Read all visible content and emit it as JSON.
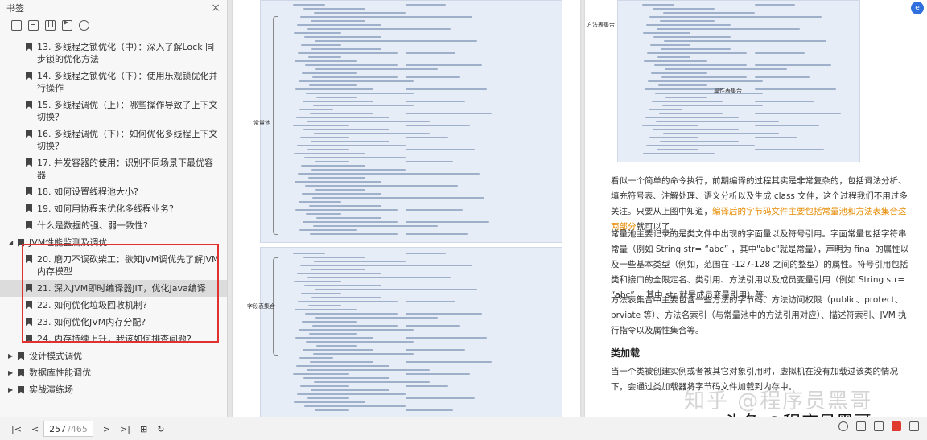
{
  "sidebar": {
    "title": "书签",
    "close": "×",
    "tools": [
      "bookmark-add-icon",
      "bookmark-remove-icon",
      "bookmark-icon",
      "bookmark-play-icon",
      "bookmark-settings-icon"
    ],
    "items": [
      {
        "label": "13. 多线程之锁优化（中）：深入了解Lock 同步锁的优化方法"
      },
      {
        "label": "14. 多线程之锁优化（下）：使用乐观锁优化并行操作"
      },
      {
        "label": "15. 多线程调优（上）：哪些操作导致了上下文切换？"
      },
      {
        "label": "16. 多线程调优（下）：如何优化多线程上下文切换？"
      },
      {
        "label": "17. 并发容器的使用：识别不同场景下最优容器"
      },
      {
        "label": "18. 如何设置线程池大小?"
      },
      {
        "label": "19. 如何用协程来优化多线程业务?"
      },
      {
        "label": "什么是数据的强、弱一致性?"
      }
    ],
    "group_jvm": "JVM性能监测及调优",
    "jvm_items": [
      {
        "label": "20. 磨刀不误砍柴工：欲知JVM调优先了解JVM内存模型"
      },
      {
        "label": "21. 深入JVM即时编译器JIT，优化Java编译"
      },
      {
        "label": "22. 如何优化垃圾回收机制?"
      },
      {
        "label": "23. 如何优化JVM内存分配?"
      },
      {
        "label": "24. 内存持续上升，我该如何排查问题?"
      }
    ],
    "groups_after": [
      {
        "label": "设计模式调优"
      },
      {
        "label": "数据库性能调优"
      },
      {
        "label": "实战演练场"
      }
    ]
  },
  "doc": {
    "labels": {
      "constant_pool": "常量池",
      "field_table": "字段表集合",
      "method_table": "方法表集合",
      "attr_table": "属性表集合"
    },
    "para1_a": "看似一个简单的命令执行，前期编译的过程其实是非常复杂的，包括词法分析、填充符号表、注解处理、语义分析以及生成 class 文件，这个过程我们不用过多关注。只要从上图中知道，",
    "para1_hl": "编译后的字节码文件主要包括常量池和方法表集合这两部分",
    "para1_b": "就可以了。",
    "para2": "常量池主要记录的是类文件中出现的字面量以及符号引用。字面常量包括字符串常量（例如 String str= “abc” ，其中\"abc\"就是常量），声明为 final 的属性以及一些基本类型（例如，范围在 -127-128 之间的整型）的属性。符号引用包括类和接口的全限定名、类引用、方法引用以及成员变量引用（例如 String str= “abc” ，其中 str 就是成员变量引用）等。",
    "para3": "方法表集合中主要包含一些方法的字节码、方法访问权限（public、protect、prviate 等）、方法名索引（与常量池中的方法引用对应）、描述符索引、JVM 执行指令以及属性集合等。",
    "heading": "类加载",
    "para4": "当一个类被创建实例或者被其它对象引用时，虚拟机在没有加载过该类的情况下，会通过类加载器将字节码文件加载到内存中。",
    "badge": "e"
  },
  "bottombar": {
    "current_page": "257",
    "total_pages": "/465"
  },
  "watermark": "知乎 @程序员黑哥",
  "watermark2": "头条 @程序员黑哥"
}
